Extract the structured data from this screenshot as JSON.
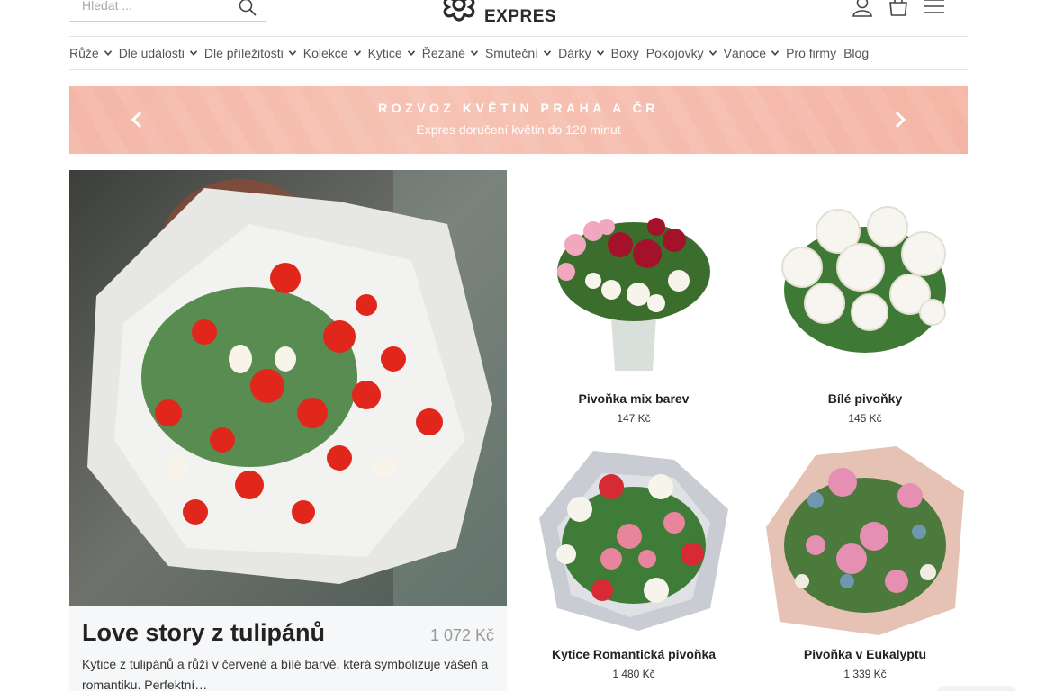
{
  "header": {
    "search_placeholder": "Hledat ...",
    "logo_text": "EXPRES",
    "icons": [
      "search-icon",
      "user-icon",
      "cart-icon",
      "menu-icon"
    ]
  },
  "nav": {
    "items": [
      {
        "label": "Růže",
        "dropdown": true
      },
      {
        "label": "Dle události",
        "dropdown": true
      },
      {
        "label": "Dle příležitosti",
        "dropdown": true
      },
      {
        "label": "Kolekce",
        "dropdown": true
      },
      {
        "label": "Kytice",
        "dropdown": true
      },
      {
        "label": "Řezané",
        "dropdown": true
      },
      {
        "label": "Smuteční",
        "dropdown": true
      },
      {
        "label": "Dárky",
        "dropdown": true
      },
      {
        "label": "Boxy",
        "dropdown": false
      },
      {
        "label": "Pokojovky",
        "dropdown": true
      },
      {
        "label": "Vánoce",
        "dropdown": true
      },
      {
        "label": "Pro firmy",
        "dropdown": false
      },
      {
        "label": "Blog",
        "dropdown": false
      }
    ]
  },
  "banner": {
    "title": "ROZVOZ KVĚTIN PRAHA A ČR",
    "subtitle": "Expres doručení květin do 120 minut"
  },
  "featured": {
    "title": "Love story z tulipánů",
    "price": "1 072 Kč",
    "description": "Kytice z tulipánů a růží v červené a bílé barvě, která symbolizuje vášeň a romantiku. Perfektní…"
  },
  "products": [
    {
      "name": "Pivoňka mix barev",
      "price": "147 Kč"
    },
    {
      "name": "Bílé pivoňky",
      "price": "145 Kč"
    },
    {
      "name": "Kytice Romantická pivoňka",
      "price": "1 480 Kč"
    },
    {
      "name": "Pivoňka v Eukalyptu",
      "price": "1 339 Kč"
    }
  ],
  "colors": {
    "banner": "#f5bcae",
    "text": "#333333",
    "muted": "#9a9a9a"
  }
}
